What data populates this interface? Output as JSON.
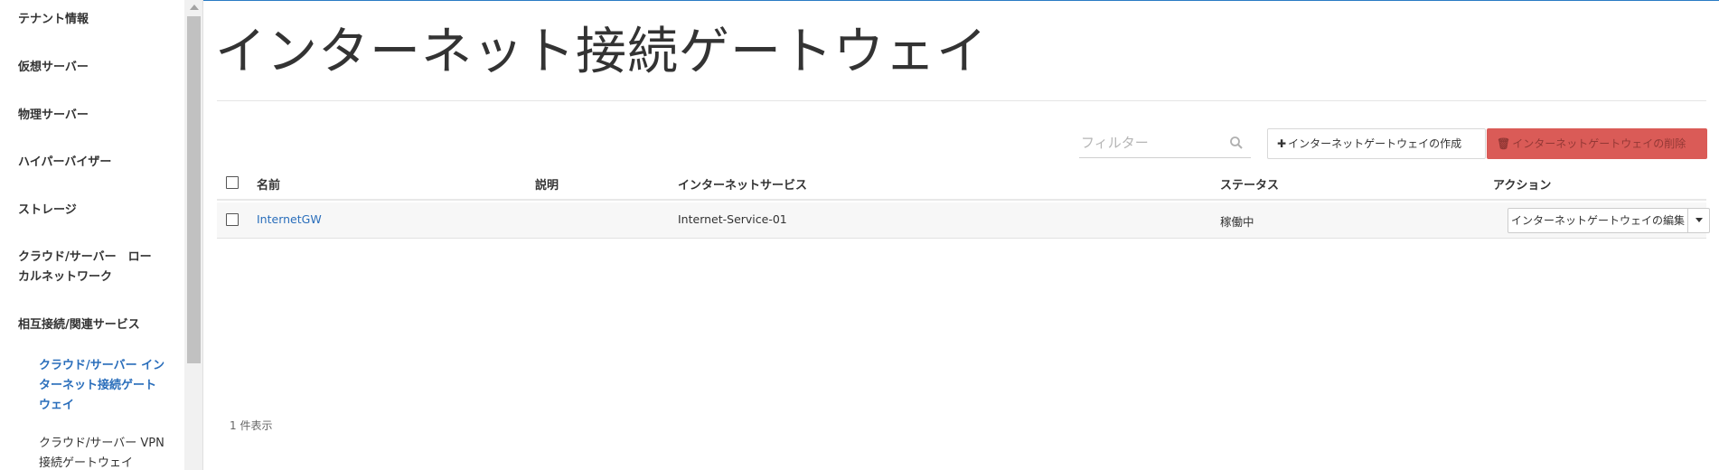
{
  "sidebar": {
    "items": [
      {
        "label": "テナント情報"
      },
      {
        "label": "仮想サーバー"
      },
      {
        "label": "物理サーバー"
      },
      {
        "label": "ハイパーバイザー"
      },
      {
        "label": "ストレージ"
      },
      {
        "label": "クラウド/サーバー　ローカルネットワーク"
      },
      {
        "label": "相互接続/関連サービス"
      }
    ],
    "sub_items": [
      {
        "label": "クラウド/サーバー インターネット接続ゲートウェイ",
        "active": true
      },
      {
        "label": "クラウド/サーバー VPN接続ゲートウェイ",
        "active": false
      }
    ]
  },
  "page": {
    "title": "インターネット接続ゲートウェイ"
  },
  "toolbar": {
    "filter_placeholder": "フィルター",
    "create_label": "インターネットゲートウェイの作成",
    "delete_label": "インターネットゲートウェイの削除"
  },
  "table": {
    "columns": [
      "名前",
      "説明",
      "インターネットサービス",
      "ステータス",
      "アクション"
    ],
    "rows": [
      {
        "name": "InternetGW",
        "description": "",
        "internet_service": "Internet-Service-01",
        "status": "稼働中",
        "action_label": "インターネットゲートウェイの編集"
      }
    ],
    "count_text": "1 件表示"
  },
  "colors": {
    "accent": "#2a6ebb",
    "danger": "#d9534f"
  }
}
